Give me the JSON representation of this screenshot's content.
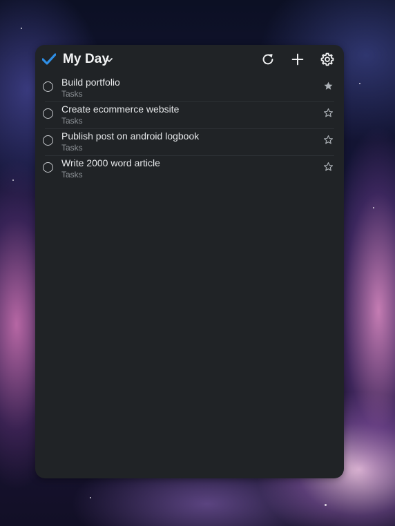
{
  "widget": {
    "title": "My Day",
    "icons": {
      "logo": "checkmark-icon",
      "dropdown": "chevron-down-icon",
      "refresh": "refresh-icon",
      "add": "plus-icon",
      "settings": "gear-icon"
    },
    "accent_color": "#2f8fe6"
  },
  "tasks": [
    {
      "title": "Build portfolio",
      "list": "Tasks",
      "starred": true
    },
    {
      "title": "Create ecommerce website",
      "list": "Tasks",
      "starred": false
    },
    {
      "title": "Publish post on android logbook",
      "list": "Tasks",
      "starred": false
    },
    {
      "title": "Write 2000 word article",
      "list": "Tasks",
      "starred": false
    }
  ]
}
